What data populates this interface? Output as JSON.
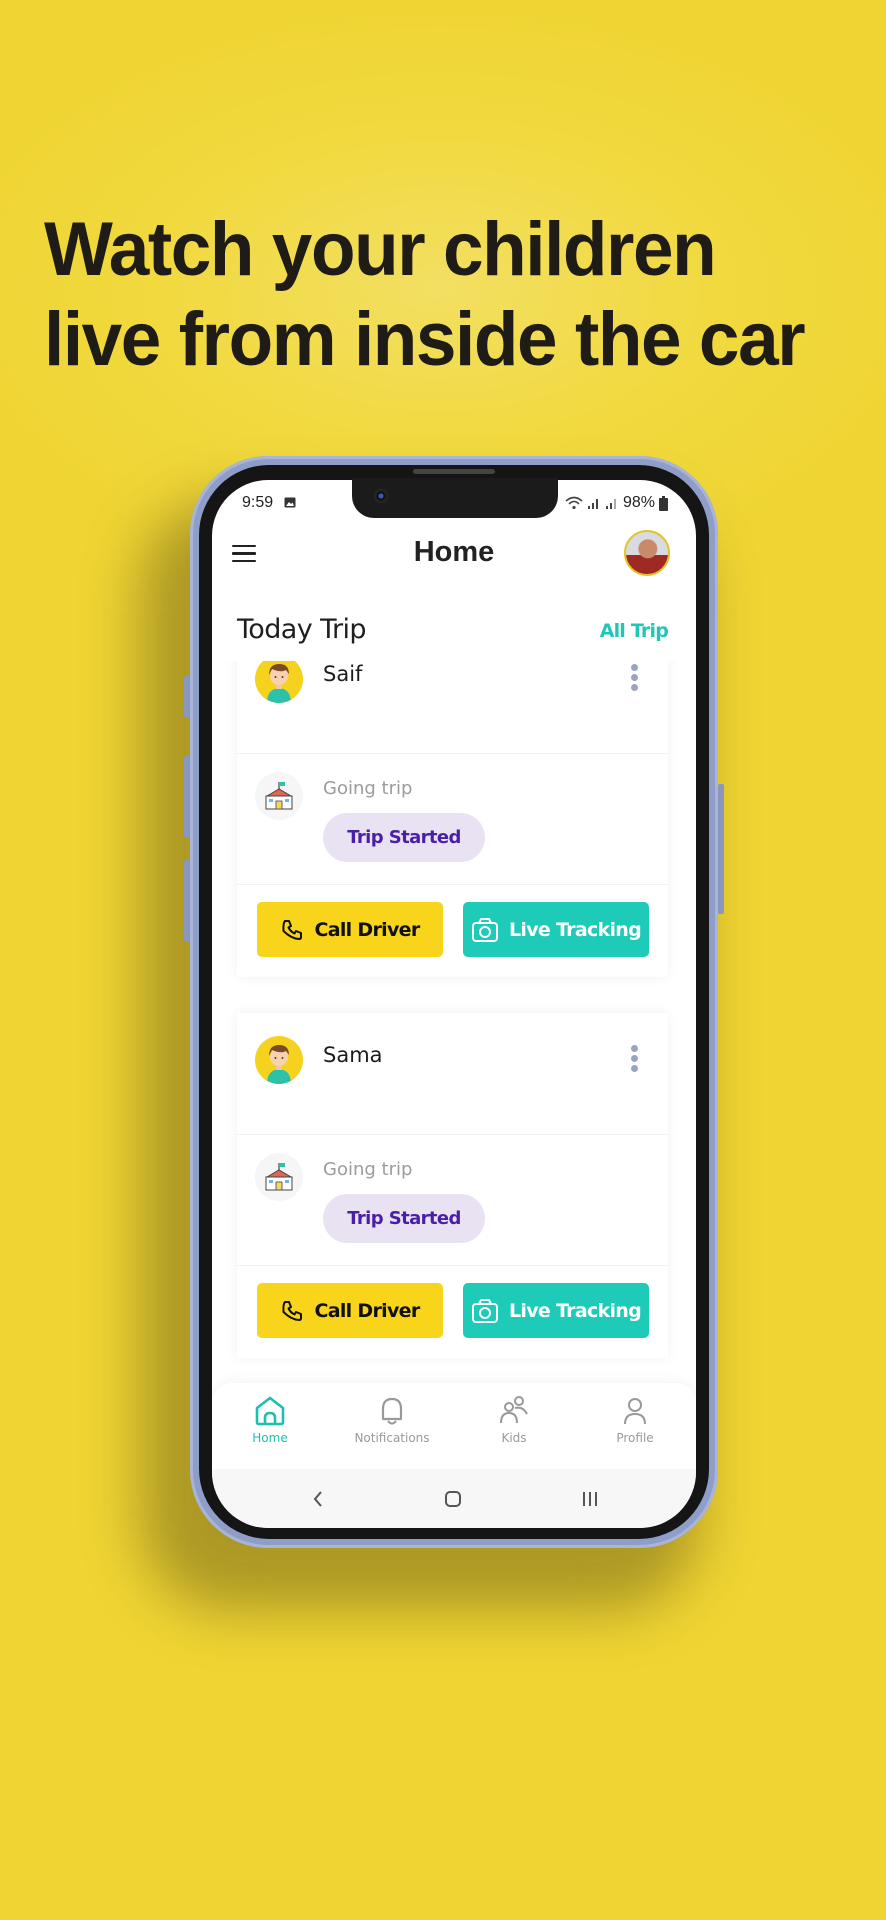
{
  "headline": {
    "line1": "Watch your children",
    "line2": "live from inside the car"
  },
  "status_bar": {
    "time": "9:59",
    "battery": "98%",
    "icons": [
      "gallery-icon",
      "wifi-icon",
      "signal-icon",
      "signal-icon",
      "battery-icon"
    ]
  },
  "topbar": {
    "title": "Home",
    "menu_icon": "hamburger-menu-icon",
    "avatar": "user-avatar"
  },
  "section": {
    "title": "Today Trip",
    "link": "All Trip"
  },
  "trips": [
    {
      "kid_name": "Saif",
      "trip_type": "Going trip",
      "status": "Trip Started",
      "call_label": "Call Driver",
      "track_label": "Live Tracking"
    },
    {
      "kid_name": "Sama",
      "trip_type": "Going trip",
      "status": "Trip Started",
      "call_label": "Call Driver",
      "track_label": "Live Tracking"
    }
  ],
  "bottom_nav": [
    {
      "label": "Home",
      "icon": "home-icon",
      "active": true
    },
    {
      "label": "Notifications",
      "icon": "bell-icon",
      "active": false
    },
    {
      "label": "Kids",
      "icon": "kids-icon",
      "active": false
    },
    {
      "label": "Profile",
      "icon": "profile-icon",
      "active": false
    }
  ],
  "system_nav": [
    "back",
    "home",
    "recents"
  ],
  "colors": {
    "background": "#f1d93e",
    "accent_teal": "#1ecbb8",
    "button_yellow": "#f8d41b",
    "pill_bg": "#e8e2f3",
    "pill_text": "#4a1fa6"
  }
}
